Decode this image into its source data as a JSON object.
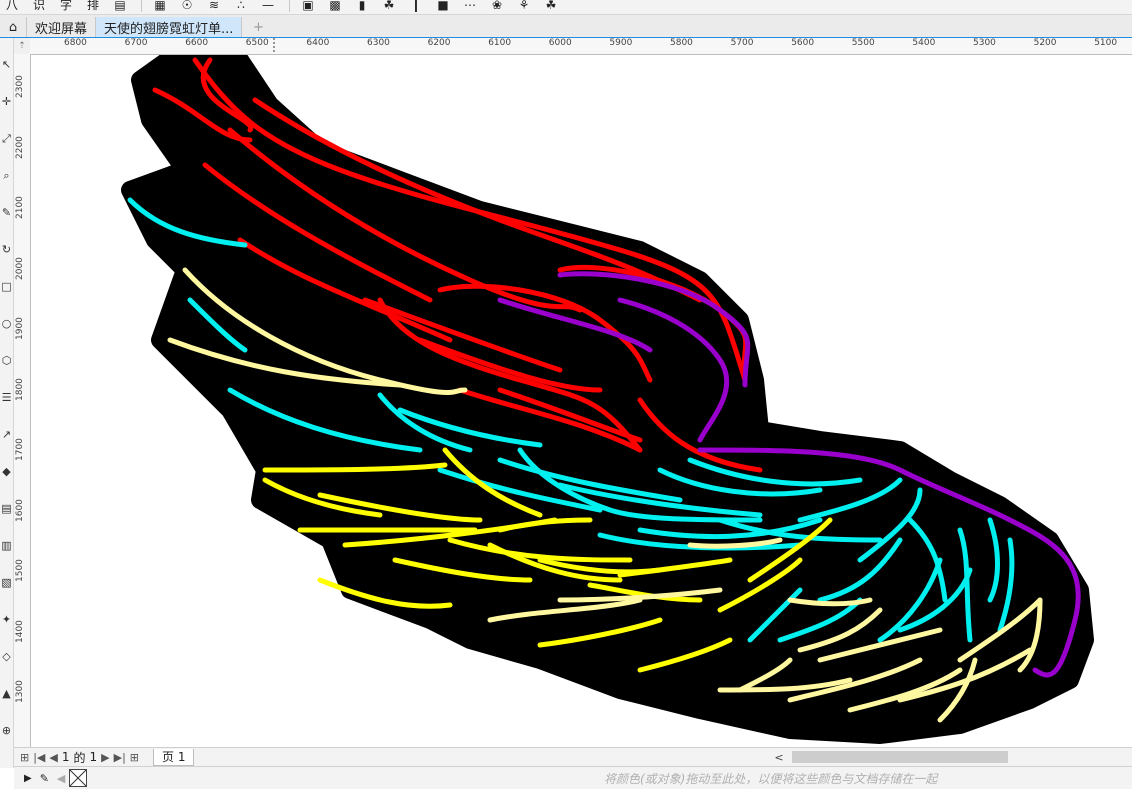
{
  "toolbar": {
    "items": [
      "八",
      "识",
      "字",
      "排",
      "▤",
      "▦",
      "☉",
      "≋",
      "∴",
      "—",
      "▣",
      "▩",
      "▮",
      "☘",
      "┃",
      "■",
      "⋯",
      "❀",
      "⚘",
      "☘"
    ],
    "separator_after": [
      4,
      9
    ]
  },
  "tabs": [
    {
      "name": "home",
      "label": "⌂"
    },
    {
      "name": "welcome",
      "label": "欢迎屏幕"
    },
    {
      "name": "document",
      "label": "天使的翅膀霓虹灯单..."
    },
    {
      "name": "add",
      "label": "+"
    }
  ],
  "ruler": {
    "corner": "⇡",
    "h_ticks": [
      "6800",
      "6700",
      "6600",
      "6500",
      "6400",
      "6300",
      "6200",
      "6100",
      "6000",
      "5900",
      "5800",
      "5700",
      "5600",
      "5500",
      "5400",
      "5300",
      "5200",
      "5100"
    ],
    "v_ticks": [
      "2300",
      "2200",
      "2100",
      "2000",
      "1900",
      "1800",
      "1700",
      "1600",
      "1500",
      "1400",
      "1300"
    ]
  },
  "left_tools": [
    "↖",
    "✛",
    "⤢",
    "⌕",
    "✎",
    "↻",
    "□",
    "○",
    "⬡",
    "☰",
    "↗",
    "◆",
    "▤",
    "▥",
    "▧",
    "✦",
    "◇",
    "▲",
    "⊕"
  ],
  "status": {
    "page_of_label": "的",
    "page_current": "1",
    "page_total": "1",
    "page_tab": "页 1",
    "scroll_left": "<"
  },
  "colorbar": {
    "hint": "将颜色(或对象)拖动至此处，以便将这些颜色与文档存储在一起"
  },
  "artwork": {
    "colors": {
      "outline": "#000000",
      "red": "#ff0000",
      "purple": "#9900cc",
      "cyan": "#00f0f0",
      "yellow": "#ffff00",
      "pale_yellow": "#fff8a0"
    }
  }
}
